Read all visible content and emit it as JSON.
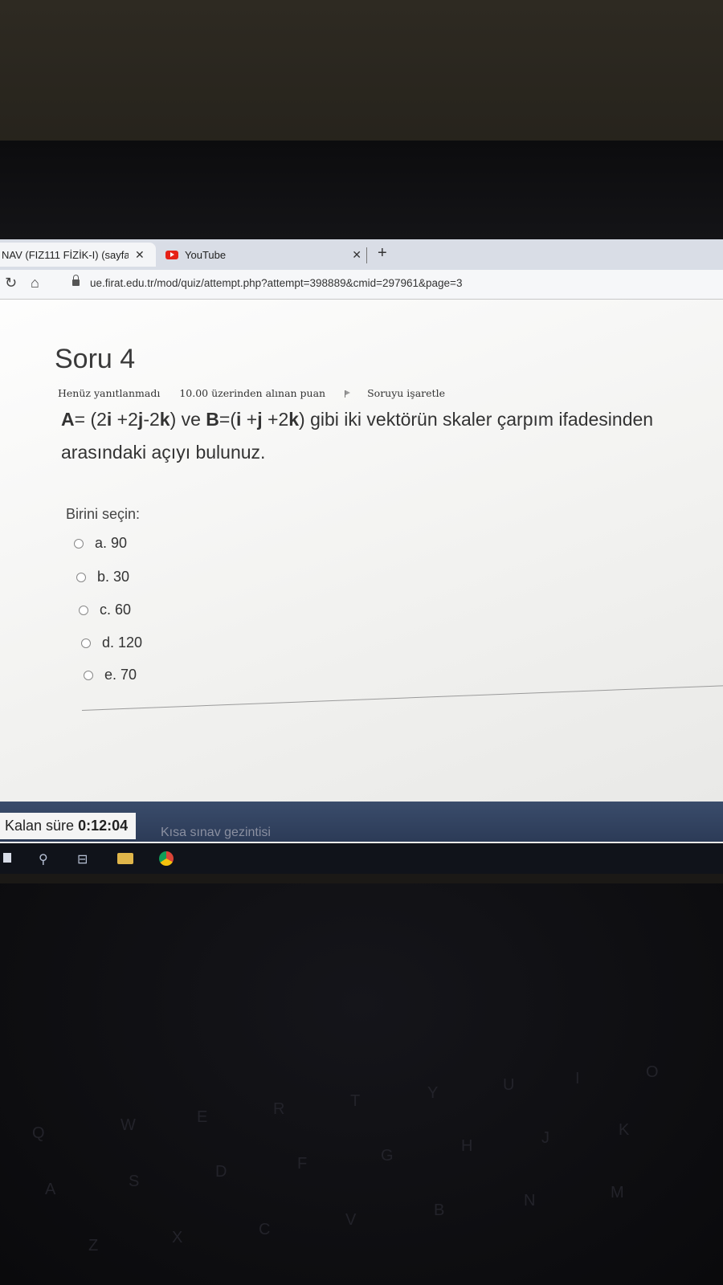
{
  "browser": {
    "tabs": [
      {
        "title": "NAV (FIZ111 FİZİK-I) (sayfa",
        "close": "✕",
        "active": true
      },
      {
        "title": "YouTube",
        "close": "✕",
        "active": false
      }
    ],
    "new_tab": "+",
    "url": "ue.firat.edu.tr/mod/quiz/attempt.php?attempt=398889&cmid=297961&page=3"
  },
  "question": {
    "title": "Soru 4",
    "status": "Henüz yanıtlanmadı",
    "points": "10.00 üzerinden alınan puan",
    "flag": "Soruyu işaretle",
    "text_line1_parts": [
      "A",
      "= (2",
      "i",
      " +2",
      "j",
      "-2",
      "k",
      ") ve ",
      "B",
      "=(",
      "i",
      " +",
      "j",
      " +2",
      "k",
      ") gibi iki vektörün skaler çarpım ifadesinden"
    ],
    "text_line2": "arasındaki açıyı bulunuz.",
    "choose_label": "Birini seçin:",
    "options": [
      "a. 90",
      "b. 30",
      "c. 60",
      "d. 120",
      "e. 70"
    ]
  },
  "timer": {
    "label": "Kalan süre",
    "value": "0:12:04"
  },
  "quiz_nav_label": "Kısa sınav gezintisi",
  "keyboard_keys": [
    "Q",
    "W",
    "E",
    "R",
    "T",
    "Y",
    "U",
    "I",
    "O",
    "A",
    "S",
    "D",
    "F",
    "G",
    "H",
    "J",
    "K",
    "Z",
    "X",
    "C",
    "V",
    "B",
    "N",
    "M"
  ]
}
